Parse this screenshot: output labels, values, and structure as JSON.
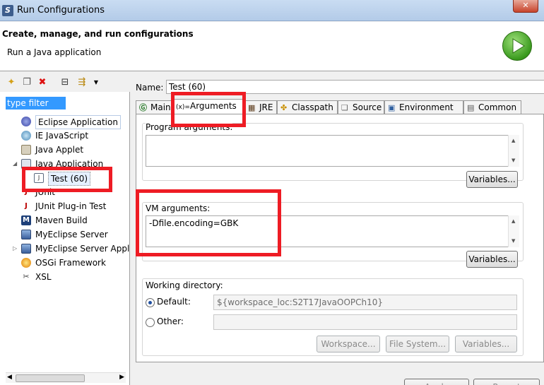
{
  "window": {
    "title": "Run Configurations"
  },
  "header": {
    "title": "Create, manage, and run configurations",
    "subtitle": "Run a Java application"
  },
  "left": {
    "filter_text": "type filter text",
    "tree": [
      {
        "label": "Eclipse Application",
        "icon": "eclipse-app-icon"
      },
      {
        "label": "IE JavaScript",
        "icon": "globe-icon"
      },
      {
        "label": "Java Applet",
        "icon": "applet-icon"
      },
      {
        "label": "Java Application",
        "icon": "java-app-icon",
        "expanded": true
      },
      {
        "label": "Test (60)",
        "icon": "java-file-icon",
        "selected": true
      },
      {
        "label": "JUnit",
        "icon": "junit-icon"
      },
      {
        "label": "JUnit Plug-in Test",
        "icon": "junit-plugin-icon"
      },
      {
        "label": "Maven Build",
        "icon": "maven-icon"
      },
      {
        "label": "MyEclipse Server",
        "icon": "server-icon"
      },
      {
        "label": "MyEclipse Server Appl",
        "icon": "server-app-icon"
      },
      {
        "label": "OSGi Framework",
        "icon": "osgi-icon"
      },
      {
        "label": "XSL",
        "icon": "xsl-icon"
      }
    ]
  },
  "right": {
    "name_label": "Name:",
    "name_value": "Test (60)",
    "tabs": [
      {
        "label": "Main",
        "icon": "main-tab-icon"
      },
      {
        "label": "Arguments",
        "icon": "arguments-tab-icon",
        "active": true
      },
      {
        "label": "JRE",
        "icon": "jre-tab-icon"
      },
      {
        "label": "Classpath",
        "icon": "classpath-tab-icon"
      },
      {
        "label": "Source",
        "icon": "source-tab-icon"
      },
      {
        "label": "Environment",
        "icon": "environment-tab-icon"
      },
      {
        "label": "Common",
        "icon": "common-tab-icon"
      }
    ],
    "program_args_label": "Program arguments:",
    "program_args_value": "",
    "variables_label": "Variables...",
    "vm_args_label": "VM arguments:",
    "vm_args_value": "-Dfile.encoding=GBK",
    "working_dir_label": "Working directory:",
    "default_label": "Default:",
    "default_value": "${workspace_loc:S2T17JavaOOPCh10}",
    "other_label": "Other:",
    "other_value": "",
    "workspace_btn": "Workspace...",
    "filesystem_btn": "File System...",
    "variables_btn": "Variables..."
  },
  "footer": {
    "apply_label": "Apply",
    "revert_label": "Revert"
  },
  "colors": {
    "highlight_red": "#ee1c24",
    "selection_blue": "#3399ff"
  }
}
